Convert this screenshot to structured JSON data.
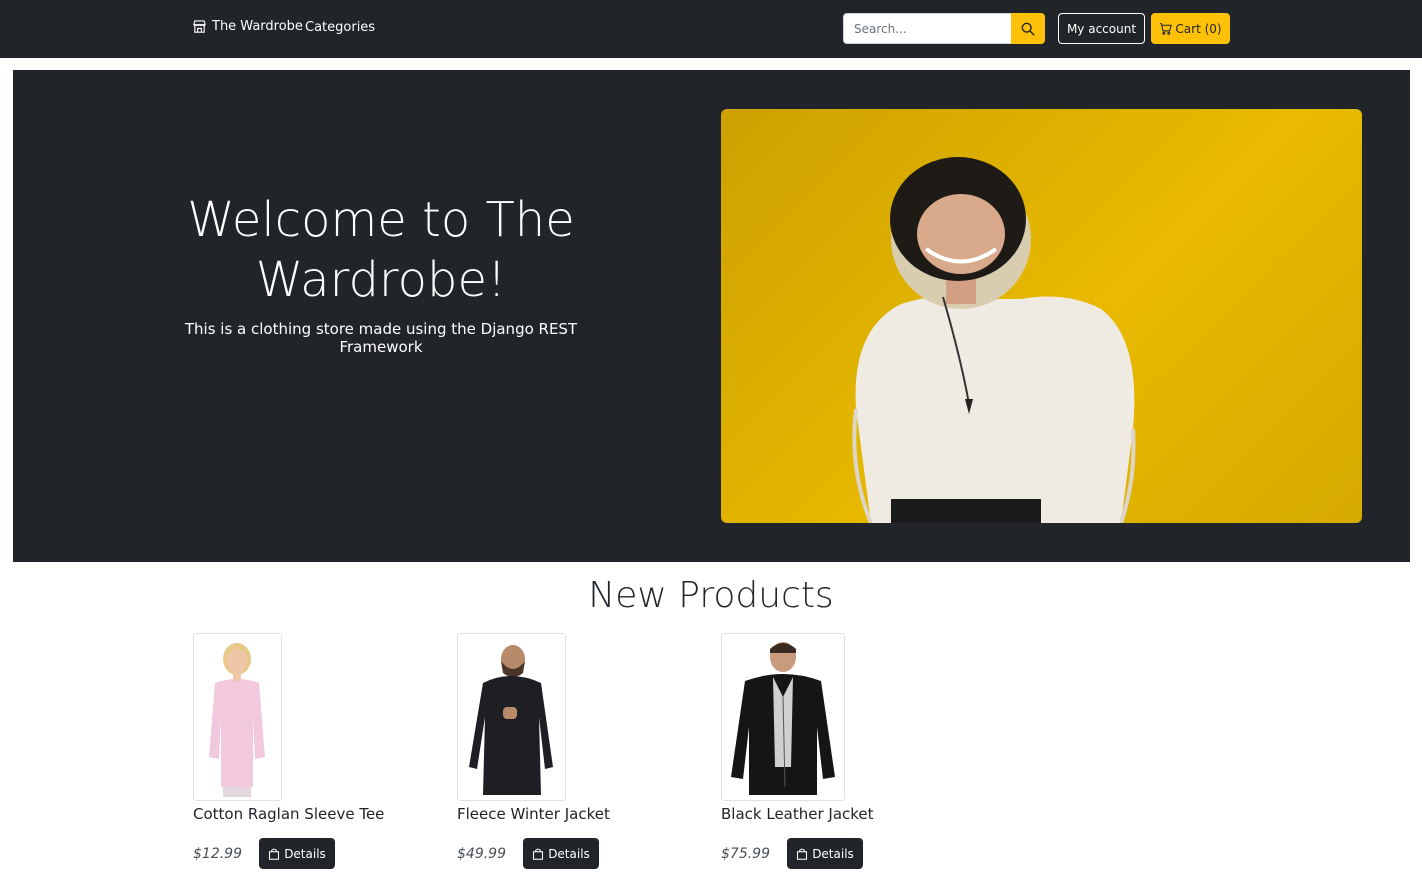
{
  "navbar": {
    "brand_label": "The Wardrobe",
    "brand_icon": "shop-icon",
    "categories_label": "Categories",
    "search_placeholder": "Search...",
    "search_icon": "search-icon",
    "account_label": "My account",
    "cart_label": "Cart (0)",
    "cart_icon": "cart-icon"
  },
  "hero": {
    "title": "Welcome to The Wardrobe!",
    "subtitle": "This is a clothing store made using the Django REST Framework"
  },
  "products_section": {
    "title": "New Products",
    "items": [
      {
        "name": "Cotton Raglan Sleeve Tee",
        "price": "$12.99",
        "button_label": "Details"
      },
      {
        "name": "Fleece Winter Jacket",
        "price": "$49.99",
        "button_label": "Details"
      },
      {
        "name": "Black Leather Jacket",
        "price": "$75.99",
        "button_label": "Details"
      }
    ]
  },
  "colors": {
    "dark": "#212529",
    "accent": "#ffc107",
    "white": "#ffffff"
  }
}
